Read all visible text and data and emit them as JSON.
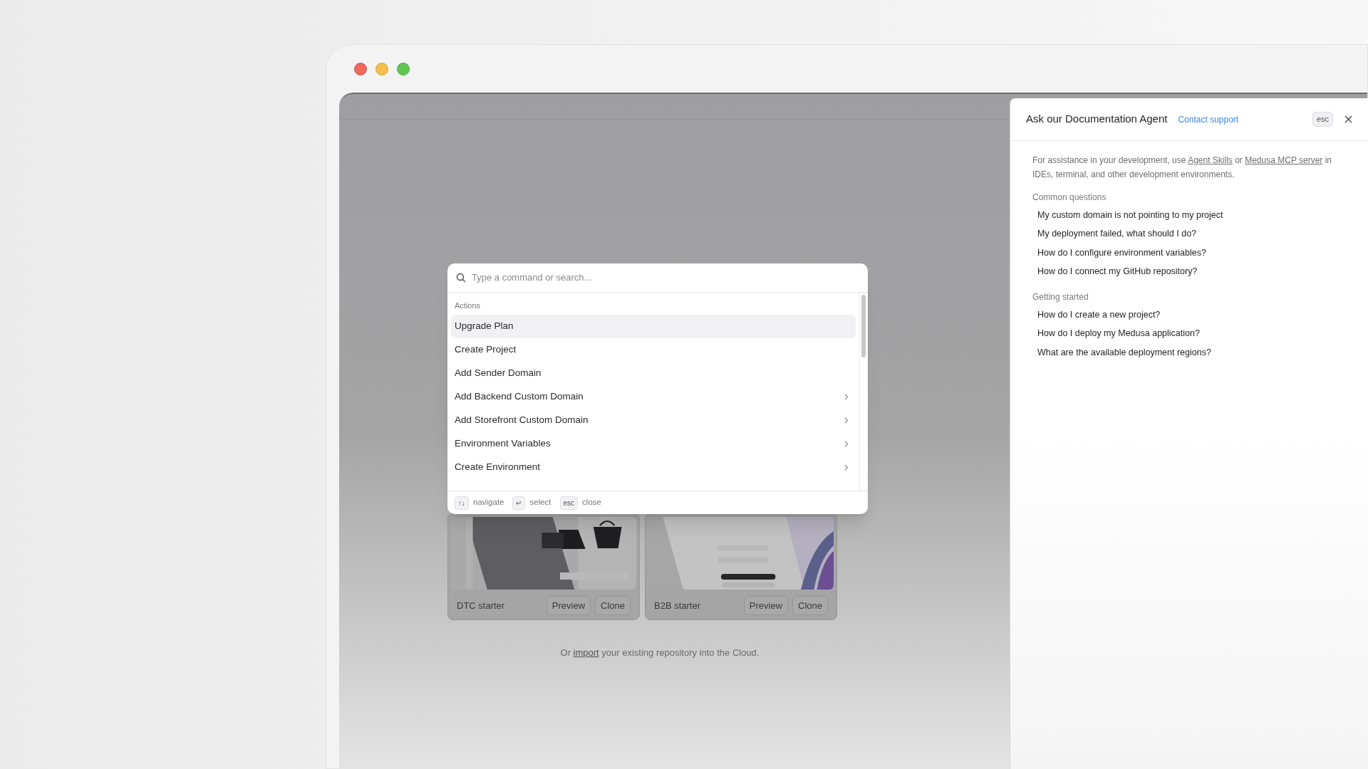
{
  "command_palette": {
    "placeholder": "Type a command or search...",
    "section": "Actions",
    "items": [
      {
        "label": "Upgrade Plan",
        "selected": true,
        "submenu": false
      },
      {
        "label": "Create Project",
        "selected": false,
        "submenu": false
      },
      {
        "label": "Add Sender Domain",
        "selected": false,
        "submenu": false
      },
      {
        "label": "Add Backend Custom Domain",
        "selected": false,
        "submenu": true
      },
      {
        "label": "Add Storefront Custom Domain",
        "selected": false,
        "submenu": true
      },
      {
        "label": "Environment Variables",
        "selected": false,
        "submenu": true
      },
      {
        "label": "Create Environment",
        "selected": false,
        "submenu": true
      }
    ],
    "hints": [
      {
        "key": "↑↓",
        "label": "navigate"
      },
      {
        "key": "↵",
        "label": "select"
      },
      {
        "key": "esc",
        "label": "close"
      }
    ]
  },
  "templates": [
    {
      "name": "DTC starter",
      "buttons": [
        "Preview",
        "Clone"
      ],
      "kind": "picture"
    },
    {
      "name": "B2B starter",
      "buttons": [
        "Preview",
        "Clone"
      ],
      "kind": "picture"
    }
  ],
  "import_note": [
    {
      "kind": "text",
      "text": "Or"
    },
    {
      "kind": "link",
      "text": "import"
    },
    {
      "kind": "text",
      "text": "your existing repository into the Cloud."
    }
  ],
  "agent_panel": {
    "title": "Ask our Documentation Agent",
    "contact_link": "Contact support",
    "esc_key": "esc",
    "intro": [
      {
        "kind": "text",
        "text": "For assistance in your development, use"
      },
      {
        "kind": "link",
        "text": "Agent Skills"
      },
      {
        "kind": "text",
        "text": "or"
      },
      {
        "kind": "link",
        "text": "Medusa MCP server"
      },
      {
        "kind": "text",
        "text": "in IDEs, terminal, and other development environments."
      }
    ],
    "sections": [
      {
        "heading": "Common questions",
        "questions": [
          "My custom domain is not pointing to my project",
          "My deployment failed, what should I do?",
          "How do I configure environment variables?",
          "How do I connect my GitHub repository?"
        ]
      },
      {
        "heading": "Getting started",
        "questions": [
          "How do I create a new project?",
          "How do I deploy my Medusa application?",
          "What are the available deployment regions?"
        ]
      }
    ]
  }
}
